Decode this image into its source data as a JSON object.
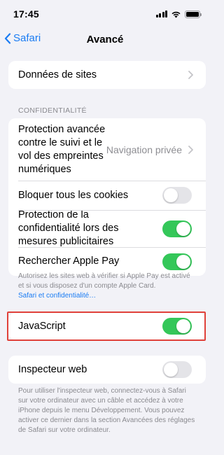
{
  "status_bar": {
    "time": "17:45"
  },
  "nav": {
    "back_label": "Safari",
    "title": "Avancé"
  },
  "sites_data": {
    "label": "Données de sites"
  },
  "privacy": {
    "header": "CONFIDENTIALITÉ",
    "tracking_label": "Protection avancée contre le suivi et le vol des empreintes numériques",
    "tracking_value": "Navigation privée",
    "block_cookies_label": "Bloquer tous les cookies",
    "block_cookies_on": false,
    "ad_privacy_label": "Protection de la confidentialité lors des mesures publicitaires",
    "ad_privacy_on": true,
    "apple_pay_label": "Rechercher Apple Pay",
    "apple_pay_on": true,
    "footnote": "Autorisez les sites web à vérifier si Apple Pay est activé et si vous disposez d'un compte Apple Card.",
    "footnote_link": "Safari et confidentialité…"
  },
  "javascript": {
    "label": "JavaScript",
    "on": true
  },
  "web_inspector": {
    "label": "Inspecteur web",
    "on": false,
    "footnote": "Pour utiliser l'inspecteur web, connectez-vous à Safari sur votre ordinateur avec un câble et accédez à votre iPhone depuis le menu Développement. Vous pouvez activer ce dernier dans la section Avancées des réglages de Safari sur votre ordinateur."
  },
  "colors": {
    "accent": "#1a7cf3",
    "toggle_on": "#34c759",
    "toggle_off": "#e4e4e8",
    "highlight": "#e0413a"
  }
}
